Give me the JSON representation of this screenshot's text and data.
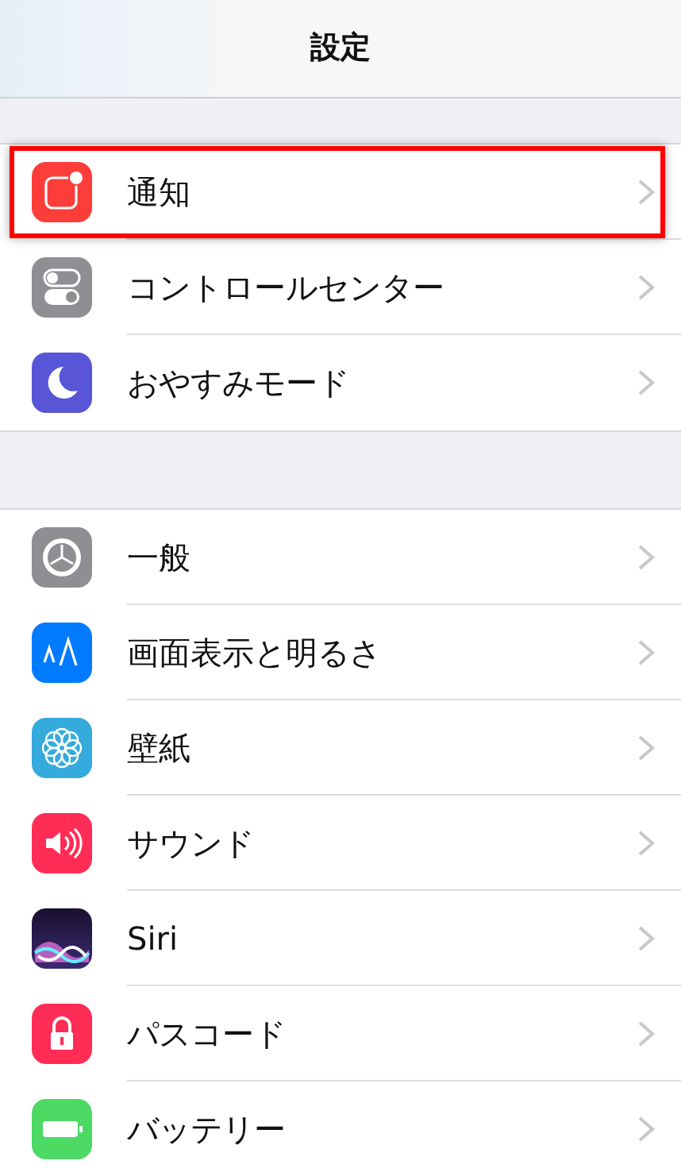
{
  "header": {
    "title": "設定"
  },
  "groups": [
    {
      "items": [
        {
          "label": "通知",
          "kind": "notifications",
          "highlighted": true
        },
        {
          "label": "コントロールセンター",
          "kind": "switches",
          "highlighted": false
        },
        {
          "label": "おやすみモード",
          "kind": "moon",
          "highlighted": false
        }
      ]
    },
    {
      "items": [
        {
          "label": "一般",
          "kind": "gear",
          "highlighted": false
        },
        {
          "label": "画面表示と明るさ",
          "kind": "display",
          "highlighted": false
        },
        {
          "label": "壁紙",
          "kind": "flower",
          "highlighted": false
        },
        {
          "label": "サウンド",
          "kind": "speaker",
          "highlighted": false
        },
        {
          "label": "Siri",
          "kind": "siri",
          "highlighted": false
        },
        {
          "label": "パスコード",
          "kind": "lock",
          "highlighted": false
        },
        {
          "label": "バッテリー",
          "kind": "battery",
          "highlighted": false
        }
      ]
    }
  ]
}
